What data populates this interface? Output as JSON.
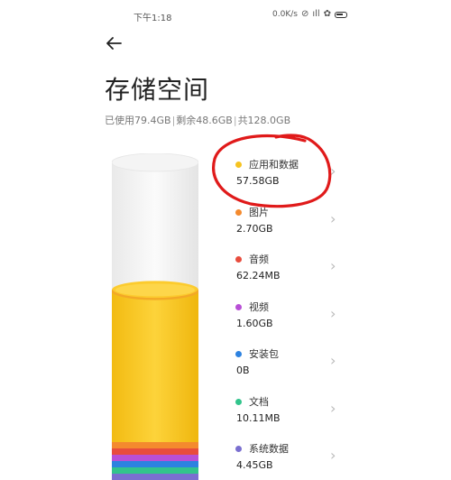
{
  "status_bar": {
    "time": "下午1:18",
    "net_speed": "0.0K/s",
    "icons": [
      "alarm-icon",
      "signal-icon",
      "wifi-icon",
      "battery-icon"
    ]
  },
  "header": {
    "back_icon": "arrow-left-icon",
    "title": "存储空间"
  },
  "summary": {
    "used": "已使用79.4GB",
    "remaining": "剩余48.6GB",
    "total": "共128.0GB"
  },
  "storage_items": [
    {
      "name": "应用和数据",
      "size": "57.58GB",
      "color": "#F6C320"
    },
    {
      "name": "图片",
      "size": "2.70GB",
      "color": "#F48A2E"
    },
    {
      "name": "音频",
      "size": "62.24MB",
      "color": "#E84C3D"
    },
    {
      "name": "视频",
      "size": "1.60GB",
      "color": "#B84FD6"
    },
    {
      "name": "安装包",
      "size": "0B",
      "color": "#2D82E0"
    },
    {
      "name": "文档",
      "size": "10.11MB",
      "color": "#32C48C"
    },
    {
      "name": "系统数据",
      "size": "4.45GB",
      "color": "#7A6FD0"
    }
  ],
  "chart_data": {
    "type": "bar",
    "total_gb": 128.0,
    "used_fraction": 0.62,
    "colors": [
      "#F6C320",
      "#F48A2E",
      "#E84C3D",
      "#B84FD6",
      "#2D82E0",
      "#32C48C",
      "#7A6FD0"
    ]
  },
  "annotation": {
    "color": "#E01A1A"
  }
}
